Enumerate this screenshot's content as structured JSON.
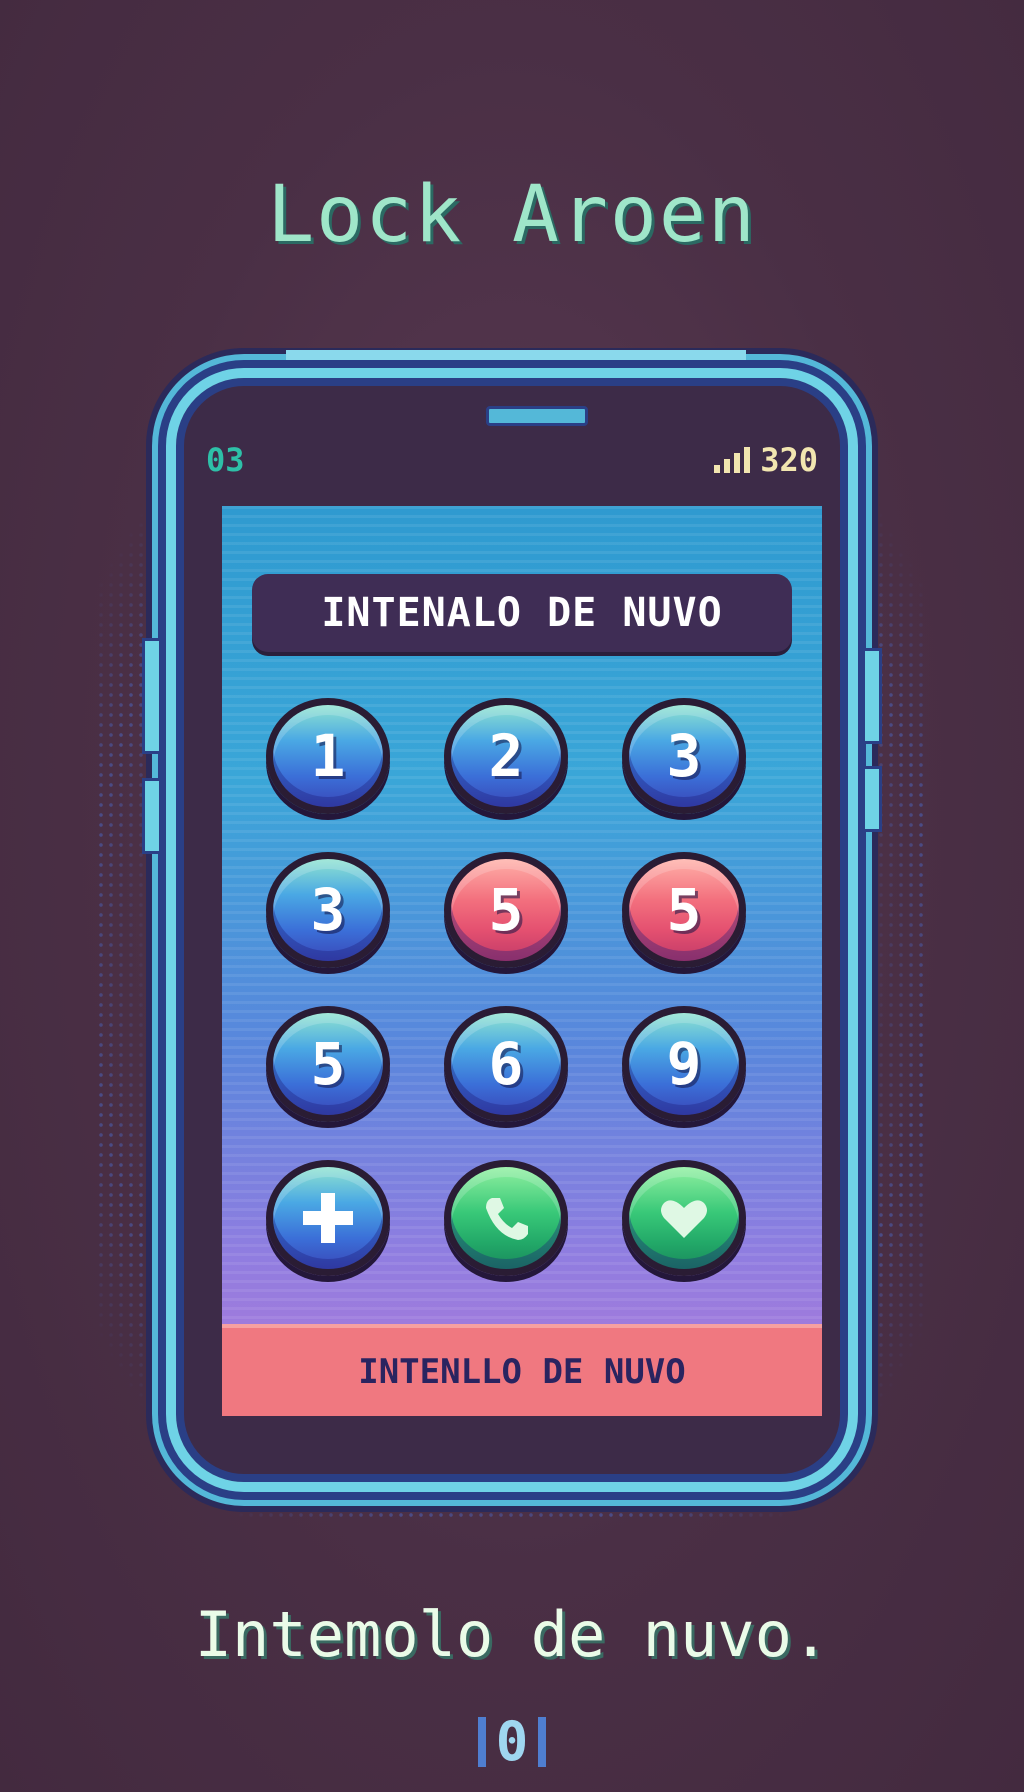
{
  "header": {
    "title": "Lock Aroen"
  },
  "status_bar": {
    "left_text": "03",
    "right_text": "320",
    "signal_icon": "signal-bars-icon"
  },
  "screen": {
    "banner_text": "INTENALO DE NUVO",
    "keypad": [
      {
        "label": "1",
        "color": "blue"
      },
      {
        "label": "2",
        "color": "blue"
      },
      {
        "label": "3",
        "color": "blue"
      },
      {
        "label": "3",
        "color": "blue"
      },
      {
        "label": "5",
        "color": "red"
      },
      {
        "label": "5",
        "color": "red"
      },
      {
        "label": "5",
        "color": "blue"
      },
      {
        "label": "6",
        "color": "blue"
      },
      {
        "label": "9",
        "color": "blue"
      }
    ],
    "action_keys": [
      {
        "icon": "plus-icon",
        "color": "blue"
      },
      {
        "icon": "phone-icon",
        "color": "green"
      },
      {
        "icon": "heart-icon",
        "color": "green"
      }
    ],
    "bottom_bar_text": "INTENLLO DE NUVO"
  },
  "footer": {
    "message": "Intemolo de nuvo.",
    "page_indicator": "0"
  },
  "colors": {
    "background": "#4a2f45",
    "title": "#9fe6c9",
    "phone_frame": "#6fd3e6",
    "banner": "#3f2d55",
    "bottom_bar": "#f07880",
    "key_blue": "#3b6fd8",
    "key_red": "#e45070",
    "key_green": "#22a868"
  }
}
